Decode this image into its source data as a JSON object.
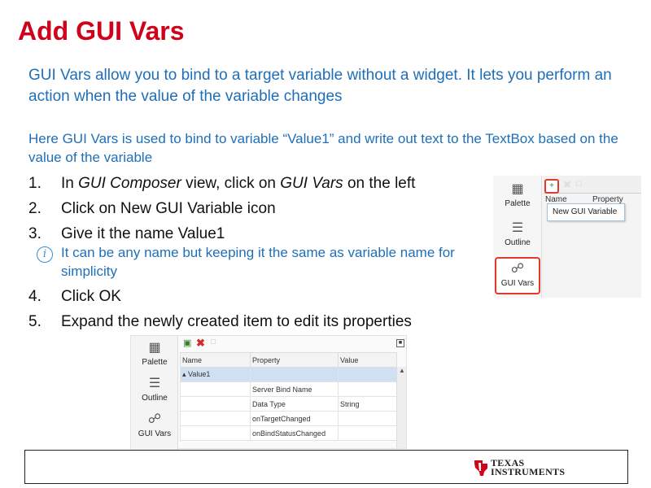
{
  "title": "Add GUI Vars",
  "intro": "GUI Vars allow you to bind to a target variable without a widget. It lets you perform an action when the value of the variable changes",
  "intro2": "Here GUI Vars is used to bind to variable “Value1” and write out text to the TextBox based on the value of the variable",
  "steps": {
    "s1": {
      "num": "1.",
      "a": "In ",
      "b": "GUI Composer",
      "c": " view, click on ",
      "d": "GUI Vars",
      "e": " on the left"
    },
    "s2": {
      "num": "2.",
      "text": "Click on New GUI Variable icon"
    },
    "s3": {
      "num": "3.",
      "text": "Give it the name Value1"
    },
    "note": "It can be any name but keeping it the same as variable name for simplicity",
    "s4": {
      "num": "4.",
      "text": "Click OK"
    },
    "s5": {
      "num": "5.",
      "text": "Expand the newly created item to edit its properties"
    }
  },
  "screenshot1": {
    "palette": "Palette",
    "outline": "Outline",
    "gui_vars": "GUI Vars",
    "col_name": "Name",
    "col_property": "Property",
    "tooltip": "New GUI Variable"
  },
  "screenshot2": {
    "palette": "Palette",
    "outline": "Outline",
    "gui_vars": "GUI Vars",
    "columns": [
      "Name",
      "Property",
      "Value"
    ],
    "rows": [
      [
        "▴ Value1",
        "",
        ""
      ],
      [
        "",
        "Server Bind Name",
        ""
      ],
      [
        "",
        "Data Type",
        "String"
      ],
      [
        "",
        "onTargetChanged",
        ""
      ],
      [
        "",
        "onBindStatusChanged",
        ""
      ]
    ]
  },
  "footer": {
    "logo_line1": "Texas",
    "logo_line2": "Instruments",
    "logo_color": "#d0021b"
  },
  "colors": {
    "title": "#d0021b",
    "body_blue": "#1f6fb8",
    "highlight_border": "#e2382e"
  }
}
